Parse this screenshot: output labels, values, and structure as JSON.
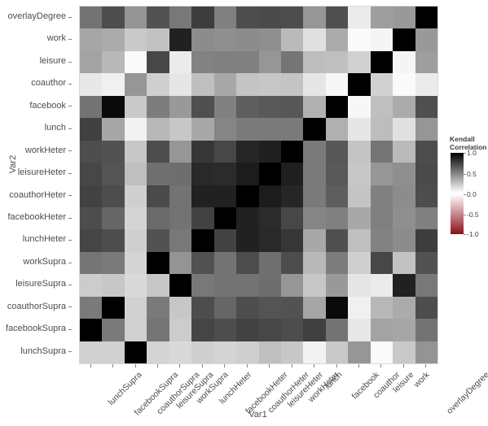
{
  "axes": {
    "xlabel": "Var1",
    "ylabel": "Var2"
  },
  "legend": {
    "title_line1": "Kendall",
    "title_line2": "Correlation",
    "ticks": [
      "1.0",
      "0.5",
      "0.0",
      "-0.5",
      "-1.0"
    ],
    "color_high": "#000000",
    "color_mid": "#ffffff",
    "color_low": "#8b0f1a",
    "scale_max": 1.0,
    "scale_min": -1.0
  },
  "chart_data": {
    "type": "heatmap",
    "title": "",
    "xlabel": "Var1",
    "ylabel": "Var2",
    "legend_title": "Kendall Correlation",
    "legend_position": "right",
    "grid": false,
    "zlim": [
      -1.0,
      1.0
    ],
    "colorscale": [
      {
        "value": 1.0,
        "color": "#000000"
      },
      {
        "value": 0.0,
        "color": "#ffffff"
      },
      {
        "value": -1.0,
        "color": "#8b0f1a"
      }
    ],
    "x": [
      "lunchSupra",
      "facebookSupra",
      "coauthorSupra",
      "leisureSupra",
      "workSupra",
      "lunchHeter",
      "facebookHeter",
      "coauthorHeter",
      "leisureHeter",
      "workHeter",
      "lunch",
      "facebook",
      "coauthor",
      "leisure",
      "work",
      "overlayDegree"
    ],
    "y": [
      "overlayDegree",
      "work",
      "leisure",
      "coauthor",
      "facebook",
      "lunch",
      "workHeter",
      "leisureHeter",
      "coauthorHeter",
      "facebookHeter",
      "lunchHeter",
      "workSupra",
      "leisureSupra",
      "coauthorSupra",
      "facebookSupra",
      "lunchSupra"
    ],
    "values": [
      [
        0.55,
        0.7,
        0.42,
        0.68,
        0.53,
        0.76,
        0.5,
        0.7,
        0.71,
        0.7,
        0.41,
        0.69,
        0.08,
        0.38,
        0.4,
        1.0
      ],
      [
        0.35,
        0.33,
        0.21,
        0.24,
        0.87,
        0.45,
        0.44,
        0.45,
        0.44,
        0.27,
        0.12,
        0.33,
        0.02,
        0.04,
        1.0,
        0.4
      ],
      [
        0.36,
        0.28,
        0.02,
        0.72,
        0.08,
        0.49,
        0.5,
        0.5,
        0.41,
        0.54,
        0.26,
        0.25,
        0.18,
        1.0,
        0.04,
        0.38
      ],
      [
        0.09,
        0.06,
        0.41,
        0.19,
        0.1,
        0.25,
        0.34,
        0.23,
        0.22,
        0.23,
        0.1,
        0.03,
        1.0,
        0.18,
        0.02,
        0.08
      ],
      [
        0.55,
        0.96,
        0.21,
        0.51,
        0.4,
        0.69,
        0.5,
        0.63,
        0.65,
        0.66,
        0.31,
        1.0,
        0.03,
        0.25,
        0.33,
        0.69
      ],
      [
        0.75,
        0.35,
        0.05,
        0.28,
        0.22,
        0.34,
        0.48,
        0.52,
        0.52,
        0.52,
        1.0,
        0.31,
        0.1,
        0.26,
        0.12,
        0.41
      ],
      [
        0.7,
        0.68,
        0.22,
        0.7,
        0.41,
        0.79,
        0.72,
        0.85,
        0.88,
        1.0,
        0.52,
        0.66,
        0.23,
        0.54,
        0.27,
        0.7
      ],
      [
        0.72,
        0.67,
        0.25,
        0.56,
        0.57,
        0.84,
        0.83,
        0.89,
        1.0,
        0.88,
        0.52,
        0.65,
        0.22,
        0.41,
        0.44,
        0.71
      ],
      [
        0.74,
        0.7,
        0.19,
        0.71,
        0.55,
        0.87,
        0.87,
        1.0,
        0.89,
        0.85,
        0.52,
        0.63,
        0.23,
        0.5,
        0.45,
        0.7
      ],
      [
        0.7,
        0.6,
        0.17,
        0.58,
        0.55,
        0.74,
        1.0,
        0.87,
        0.83,
        0.72,
        0.48,
        0.5,
        0.34,
        0.5,
        0.44,
        0.5
      ],
      [
        0.73,
        0.7,
        0.19,
        0.68,
        0.53,
        1.0,
        0.74,
        0.87,
        0.84,
        0.79,
        0.34,
        0.69,
        0.25,
        0.49,
        0.45,
        0.76
      ],
      [
        0.54,
        0.52,
        0.17,
        1.0,
        0.42,
        0.68,
        0.55,
        0.7,
        0.56,
        0.7,
        0.28,
        0.51,
        0.19,
        0.72,
        0.24,
        0.68
      ],
      [
        0.2,
        0.22,
        0.15,
        0.22,
        1.0,
        0.53,
        0.55,
        0.55,
        0.57,
        0.41,
        0.22,
        0.4,
        0.1,
        0.08,
        0.87,
        0.53
      ],
      [
        0.52,
        1.0,
        0.18,
        0.52,
        0.22,
        0.7,
        0.6,
        0.7,
        0.67,
        0.68,
        0.35,
        0.96,
        0.06,
        0.28,
        0.33,
        0.7
      ],
      [
        1.0,
        0.52,
        0.18,
        0.54,
        0.2,
        0.73,
        0.7,
        0.74,
        0.72,
        0.7,
        0.75,
        0.55,
        0.09,
        0.36,
        0.35,
        0.55
      ],
      [
        0.18,
        0.18,
        1.0,
        0.17,
        0.15,
        0.19,
        0.17,
        0.19,
        0.25,
        0.22,
        0.05,
        0.21,
        0.41,
        0.02,
        0.21,
        0.42
      ]
    ]
  }
}
